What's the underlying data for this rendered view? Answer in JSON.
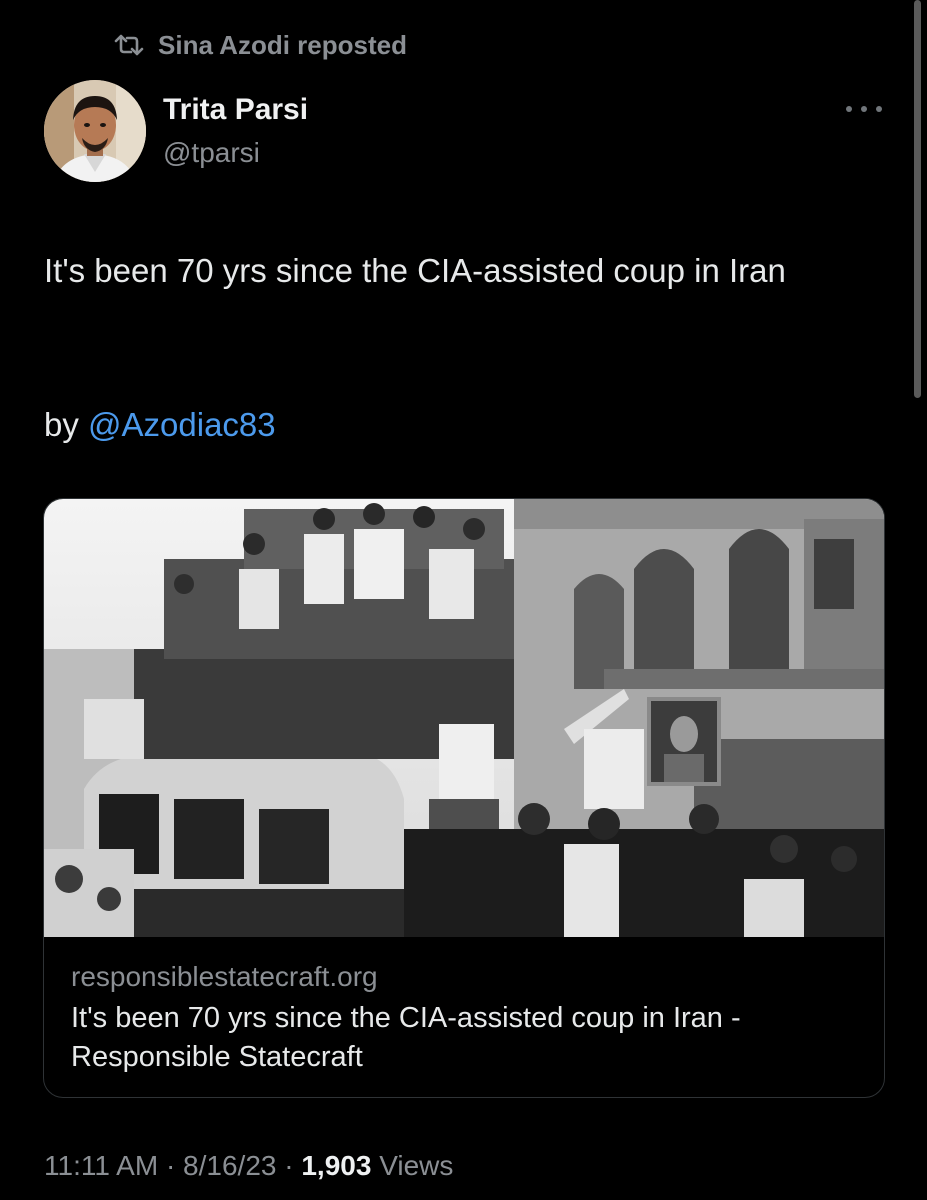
{
  "repost": {
    "text": "Sina Azodi reposted",
    "icon": "repost-icon"
  },
  "author": {
    "name": "Trita Parsi",
    "handle": "@tparsi",
    "avatar_icon": "avatar-photo"
  },
  "more_icon": "more-horizontal-icon",
  "tweet": {
    "text": "It's been 70 yrs since the CIA-assisted coup in Iran",
    "by_label": "by",
    "mention": "@Azodiac83"
  },
  "card": {
    "image_icon": "historical-photo-crowd-on-bus",
    "domain": "responsiblestatecraft.org",
    "title": "It's been 70 yrs since the CIA-assisted coup in Iran - Responsible Statecraft"
  },
  "meta": {
    "time": "11:11 AM",
    "separator": "·",
    "date": "8/16/23",
    "views_count": "1,903",
    "views_label": "Views"
  },
  "colors": {
    "background": "#000000",
    "text": "#e7e9ea",
    "secondary": "#8b8f94",
    "link": "#4c9aec",
    "border": "#2f3336"
  }
}
